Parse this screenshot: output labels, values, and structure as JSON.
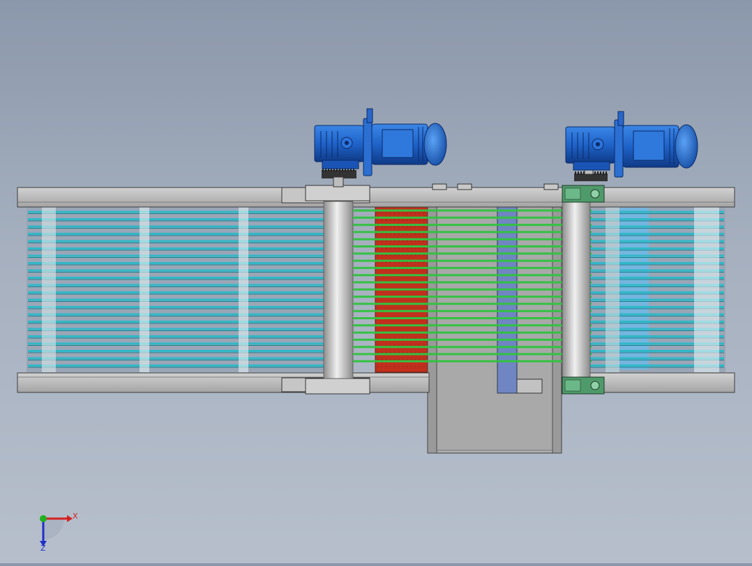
{
  "scene": {
    "type": "cad-assembly-view",
    "background_top": "#8b98ab",
    "background_bottom": "#b7bfcc"
  },
  "colors": {
    "frame": "#b9b9b9",
    "frame_edge": "#3c3c3c",
    "belt_cyan": "#2fb8c8",
    "belt_green": "#33c241",
    "motor_blue": "#1f63c9",
    "motor_dark": "#123b86",
    "red_panel": "#c0301c",
    "bearing_green": "#4f9a6a",
    "plate_gray": "#b0b0b0",
    "slot_blue": "#6f86c2"
  },
  "axis_triad": {
    "x_label": "X",
    "z_label": "Z",
    "x_color": "#d42020",
    "z_color": "#2030c8",
    "y_color": "#20b020"
  },
  "components": {
    "motor_count": 2,
    "belt_cyan_count": 22,
    "belt_green_count": 22
  }
}
